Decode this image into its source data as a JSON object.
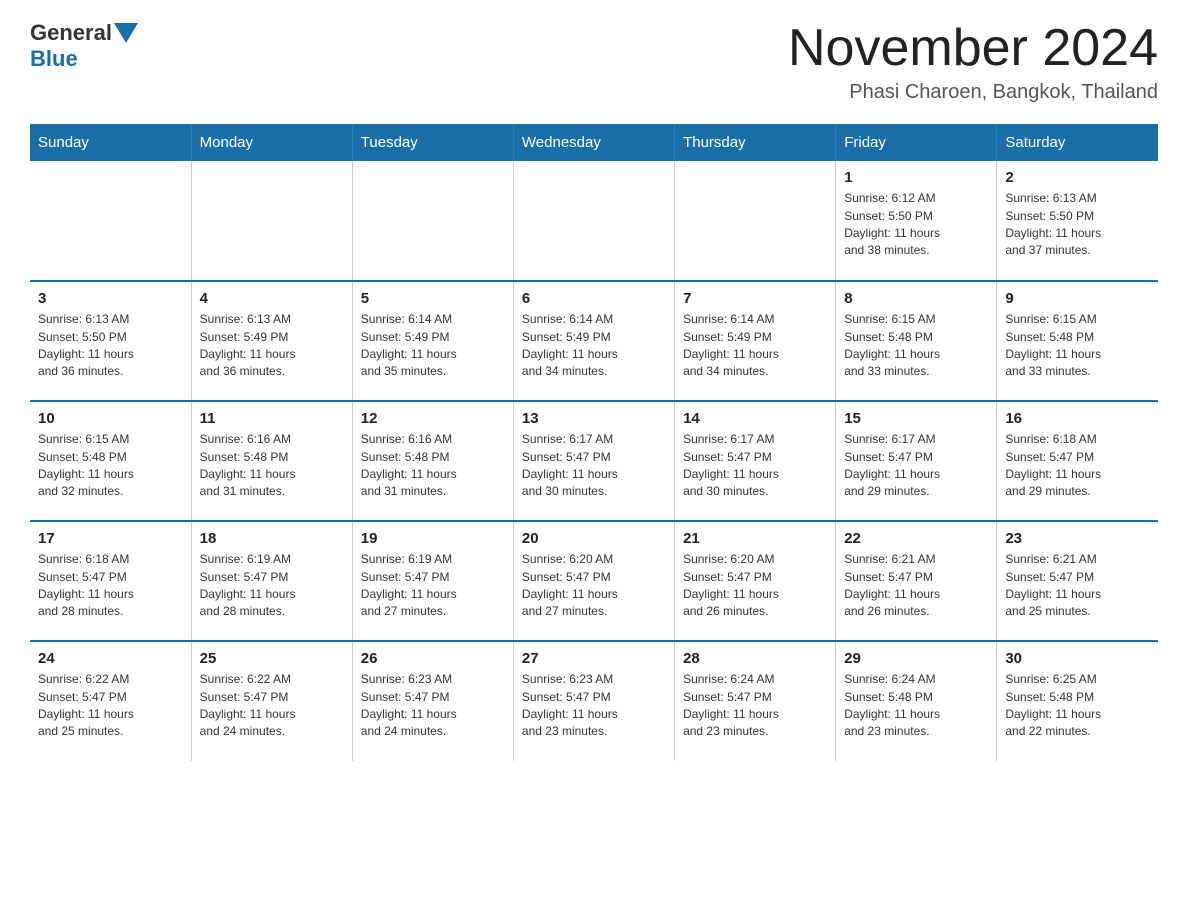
{
  "logo": {
    "text_general": "General",
    "text_blue": "Blue"
  },
  "title": "November 2024",
  "location": "Phasi Charoen, Bangkok, Thailand",
  "weekdays": [
    "Sunday",
    "Monday",
    "Tuesday",
    "Wednesday",
    "Thursday",
    "Friday",
    "Saturday"
  ],
  "weeks": [
    [
      {
        "day": "",
        "info": ""
      },
      {
        "day": "",
        "info": ""
      },
      {
        "day": "",
        "info": ""
      },
      {
        "day": "",
        "info": ""
      },
      {
        "day": "",
        "info": ""
      },
      {
        "day": "1",
        "info": "Sunrise: 6:12 AM\nSunset: 5:50 PM\nDaylight: 11 hours\nand 38 minutes."
      },
      {
        "day": "2",
        "info": "Sunrise: 6:13 AM\nSunset: 5:50 PM\nDaylight: 11 hours\nand 37 minutes."
      }
    ],
    [
      {
        "day": "3",
        "info": "Sunrise: 6:13 AM\nSunset: 5:50 PM\nDaylight: 11 hours\nand 36 minutes."
      },
      {
        "day": "4",
        "info": "Sunrise: 6:13 AM\nSunset: 5:49 PM\nDaylight: 11 hours\nand 36 minutes."
      },
      {
        "day": "5",
        "info": "Sunrise: 6:14 AM\nSunset: 5:49 PM\nDaylight: 11 hours\nand 35 minutes."
      },
      {
        "day": "6",
        "info": "Sunrise: 6:14 AM\nSunset: 5:49 PM\nDaylight: 11 hours\nand 34 minutes."
      },
      {
        "day": "7",
        "info": "Sunrise: 6:14 AM\nSunset: 5:49 PM\nDaylight: 11 hours\nand 34 minutes."
      },
      {
        "day": "8",
        "info": "Sunrise: 6:15 AM\nSunset: 5:48 PM\nDaylight: 11 hours\nand 33 minutes."
      },
      {
        "day": "9",
        "info": "Sunrise: 6:15 AM\nSunset: 5:48 PM\nDaylight: 11 hours\nand 33 minutes."
      }
    ],
    [
      {
        "day": "10",
        "info": "Sunrise: 6:15 AM\nSunset: 5:48 PM\nDaylight: 11 hours\nand 32 minutes."
      },
      {
        "day": "11",
        "info": "Sunrise: 6:16 AM\nSunset: 5:48 PM\nDaylight: 11 hours\nand 31 minutes."
      },
      {
        "day": "12",
        "info": "Sunrise: 6:16 AM\nSunset: 5:48 PM\nDaylight: 11 hours\nand 31 minutes."
      },
      {
        "day": "13",
        "info": "Sunrise: 6:17 AM\nSunset: 5:47 PM\nDaylight: 11 hours\nand 30 minutes."
      },
      {
        "day": "14",
        "info": "Sunrise: 6:17 AM\nSunset: 5:47 PM\nDaylight: 11 hours\nand 30 minutes."
      },
      {
        "day": "15",
        "info": "Sunrise: 6:17 AM\nSunset: 5:47 PM\nDaylight: 11 hours\nand 29 minutes."
      },
      {
        "day": "16",
        "info": "Sunrise: 6:18 AM\nSunset: 5:47 PM\nDaylight: 11 hours\nand 29 minutes."
      }
    ],
    [
      {
        "day": "17",
        "info": "Sunrise: 6:18 AM\nSunset: 5:47 PM\nDaylight: 11 hours\nand 28 minutes."
      },
      {
        "day": "18",
        "info": "Sunrise: 6:19 AM\nSunset: 5:47 PM\nDaylight: 11 hours\nand 28 minutes."
      },
      {
        "day": "19",
        "info": "Sunrise: 6:19 AM\nSunset: 5:47 PM\nDaylight: 11 hours\nand 27 minutes."
      },
      {
        "day": "20",
        "info": "Sunrise: 6:20 AM\nSunset: 5:47 PM\nDaylight: 11 hours\nand 27 minutes."
      },
      {
        "day": "21",
        "info": "Sunrise: 6:20 AM\nSunset: 5:47 PM\nDaylight: 11 hours\nand 26 minutes."
      },
      {
        "day": "22",
        "info": "Sunrise: 6:21 AM\nSunset: 5:47 PM\nDaylight: 11 hours\nand 26 minutes."
      },
      {
        "day": "23",
        "info": "Sunrise: 6:21 AM\nSunset: 5:47 PM\nDaylight: 11 hours\nand 25 minutes."
      }
    ],
    [
      {
        "day": "24",
        "info": "Sunrise: 6:22 AM\nSunset: 5:47 PM\nDaylight: 11 hours\nand 25 minutes."
      },
      {
        "day": "25",
        "info": "Sunrise: 6:22 AM\nSunset: 5:47 PM\nDaylight: 11 hours\nand 24 minutes."
      },
      {
        "day": "26",
        "info": "Sunrise: 6:23 AM\nSunset: 5:47 PM\nDaylight: 11 hours\nand 24 minutes."
      },
      {
        "day": "27",
        "info": "Sunrise: 6:23 AM\nSunset: 5:47 PM\nDaylight: 11 hours\nand 23 minutes."
      },
      {
        "day": "28",
        "info": "Sunrise: 6:24 AM\nSunset: 5:47 PM\nDaylight: 11 hours\nand 23 minutes."
      },
      {
        "day": "29",
        "info": "Sunrise: 6:24 AM\nSunset: 5:48 PM\nDaylight: 11 hours\nand 23 minutes."
      },
      {
        "day": "30",
        "info": "Sunrise: 6:25 AM\nSunset: 5:48 PM\nDaylight: 11 hours\nand 22 minutes."
      }
    ]
  ]
}
